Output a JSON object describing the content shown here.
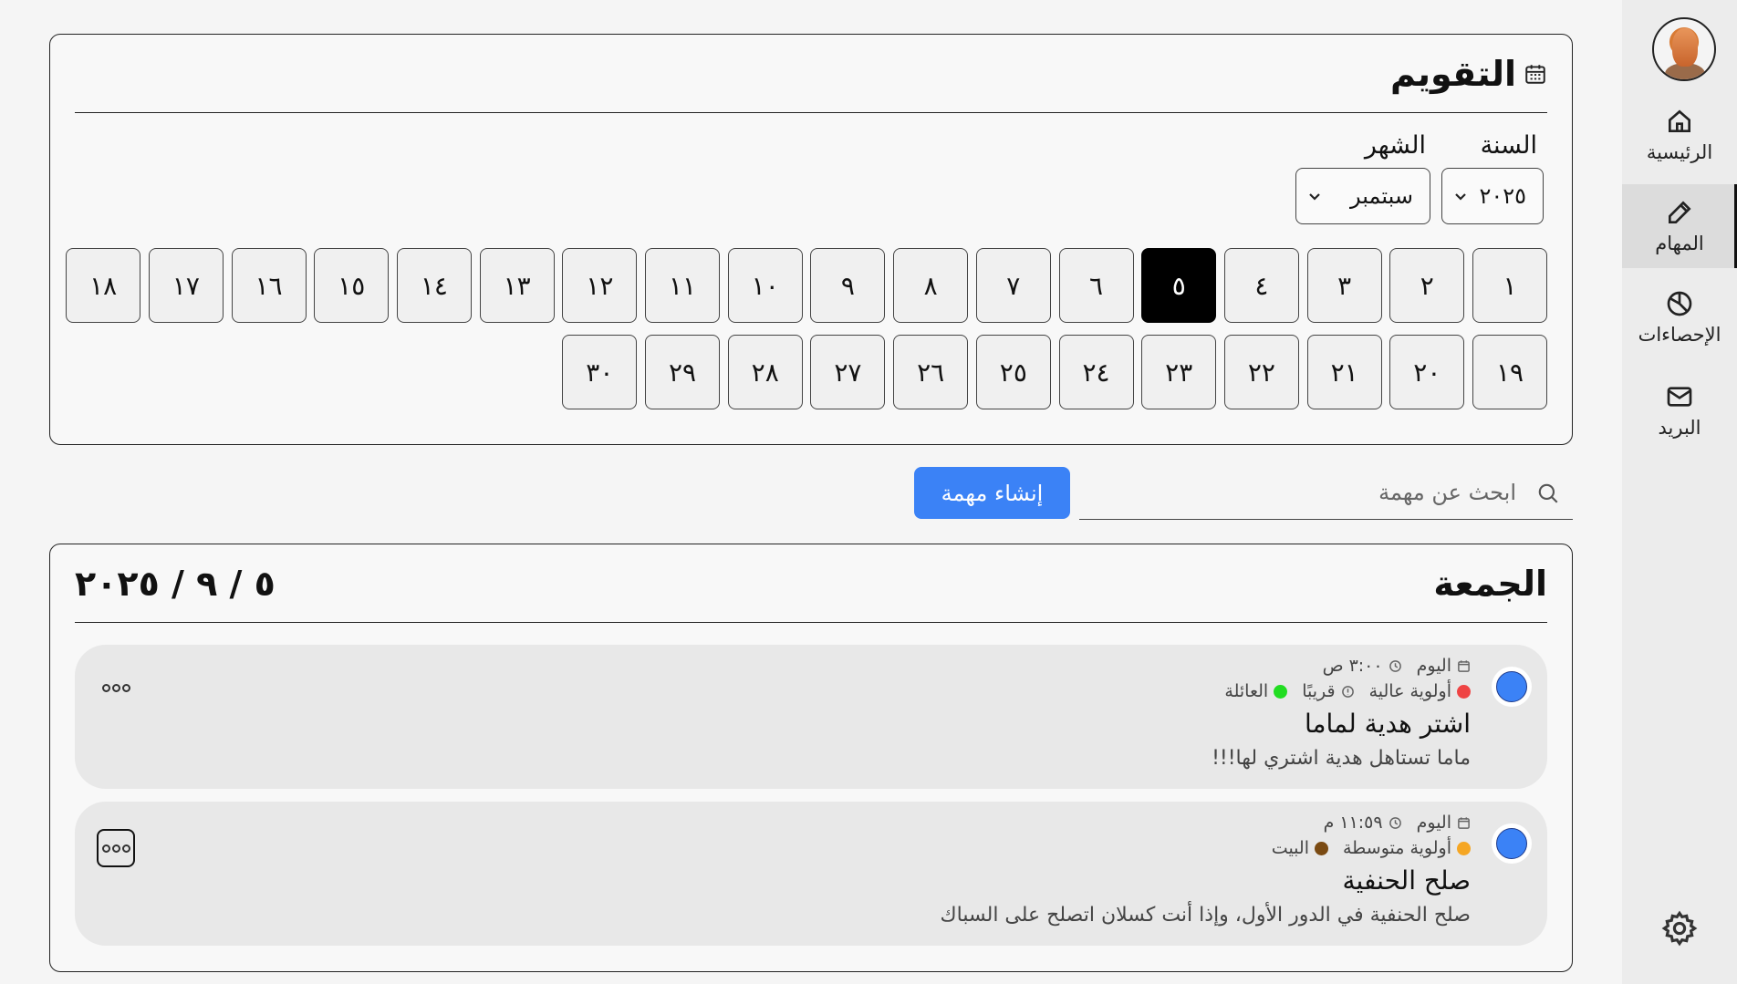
{
  "sidebar": {
    "items": [
      {
        "label": "الرئيسية",
        "icon": "home-icon"
      },
      {
        "label": "المهام",
        "icon": "pencil-icon",
        "active": true
      },
      {
        "label": "الإحصاءات",
        "icon": "chart-pie-icon"
      },
      {
        "label": "البريد",
        "icon": "mail-icon"
      }
    ],
    "settings_icon": "gear-icon"
  },
  "calendar": {
    "title": "التقويم",
    "year_label": "السنة",
    "month_label": "الشهر",
    "year_value": "٢٠٢٥",
    "month_value": "سبتمبر",
    "selected_day": "٥",
    "days": [
      "١",
      "٢",
      "٣",
      "٤",
      "٥",
      "٦",
      "٧",
      "٨",
      "٩",
      "١٠",
      "١١",
      "١٢",
      "١٣",
      "١٤",
      "١٥",
      "١٦",
      "١٧",
      "١٨",
      "١٩",
      "٢٠",
      "٢١",
      "٢٢",
      "٢٣",
      "٢٤",
      "٢٥",
      "٢٦",
      "٢٧",
      "٢٨",
      "٢٩",
      "٣٠"
    ]
  },
  "search": {
    "placeholder": "ابحث عن مهمة"
  },
  "create_button": "إنشاء مهمة",
  "day_view": {
    "day_name": "الجمعة",
    "date": "٥ / ٩ / ٢٠٢٥"
  },
  "tasks": [
    {
      "date": "اليوم",
      "time": "٣:٠٠ ص",
      "priority": "أولوية عالية",
      "priority_color": "#ef4444",
      "due": "قريبًا",
      "category": "العائلة",
      "category_color": "#22dd22",
      "title": "اشتر هدية لماما",
      "description": "ماما تستاهل هدية اشتري لها!!!"
    },
    {
      "date": "اليوم",
      "time": "١١:٥٩ م",
      "priority": "أولوية متوسطة",
      "priority_color": "#f5a623",
      "category": "البيت",
      "category_color": "#7a4a12",
      "title": "صلح الحنفية",
      "description": "صلح الحنفية في الدور الأول، وإذا أنت كسلان اتصلح على السباك"
    }
  ],
  "colors": {
    "accent": "#3b82f6",
    "selected_day_bg": "#000000"
  }
}
